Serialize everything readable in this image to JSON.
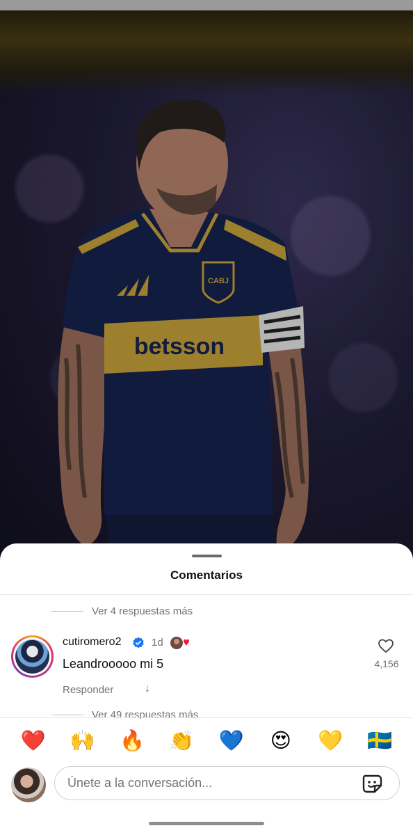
{
  "sheet": {
    "title": "Comentarios",
    "replies_above": "Ver 4 respuestas más",
    "replies_below": "Ver 49 respuestas más"
  },
  "comment": {
    "username": "cutiromero2",
    "verified": true,
    "time": "1d",
    "text": "Leandrooooo mi 5",
    "reply_label": "Responder",
    "likes": "4,156"
  },
  "emoji_bar": [
    "❤️",
    "🙌",
    "🔥",
    "👏",
    "💙",
    "😍",
    "💛",
    "🇸🇪"
  ],
  "composer": {
    "placeholder": "Únete a la conversación..."
  },
  "photo": {
    "jersey_sponsor": "betsson",
    "crest_text": "CABJ"
  },
  "colors": {
    "accent_blue": "#1877f2",
    "jersey_blue": "#17234f",
    "jersey_gold": "#c9a53c",
    "muted_text": "#737373"
  }
}
